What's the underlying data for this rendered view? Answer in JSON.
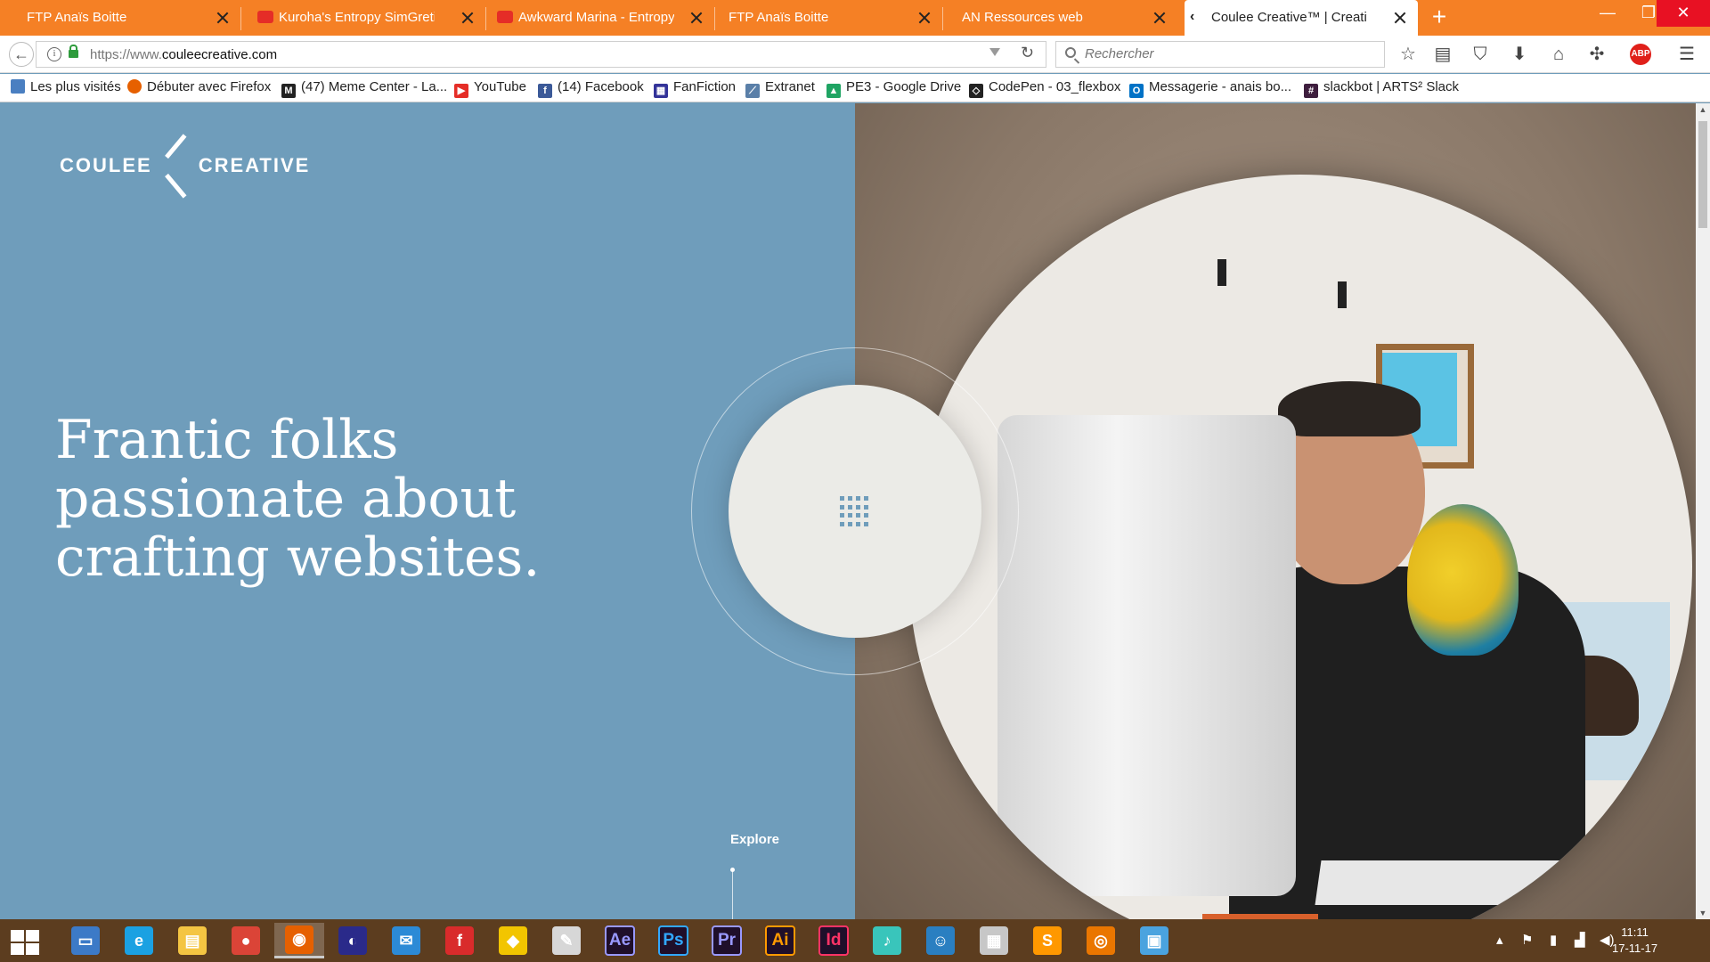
{
  "browser": {
    "tabs": [
      {
        "title": "FTP Anaïs Boitte",
        "favicon": "none"
      },
      {
        "title": "Kuroha's Entropy SimGretina",
        "favicon": "youtube-icon"
      },
      {
        "title": "Awkward Marina - Entropy",
        "favicon": "youtube-icon"
      },
      {
        "title": "FTP Anaïs Boitte",
        "favicon": "none"
      },
      {
        "title": "AN Ressources web",
        "favicon": "none"
      },
      {
        "title": "Coulee Creative™ | Creative",
        "favicon": "coulee-icon"
      }
    ],
    "new_tab_label": "+",
    "url_prefix": "https://www.",
    "url_domain": "couleecreative.com",
    "search_placeholder": "Rechercher",
    "abp_label": "ABP",
    "accent_color": "#f58025"
  },
  "bookmarks": [
    {
      "label": "Les plus visités",
      "icon": "folder-icon",
      "color": "#4a7fc1"
    },
    {
      "label": "Débuter avec Firefox",
      "icon": "firefox-icon",
      "color": "#e66000"
    },
    {
      "label": "(47) Meme Center - La...",
      "icon": "memecenter-icon",
      "color": "#222"
    },
    {
      "label": "YouTube",
      "icon": "youtube-icon",
      "color": "#e52d27"
    },
    {
      "label": "(14) Facebook",
      "icon": "facebook-icon",
      "color": "#3b5998"
    },
    {
      "label": "FanFiction",
      "icon": "fanfiction-icon",
      "color": "#333399"
    },
    {
      "label": "Extranet",
      "icon": "extranet-icon",
      "color": "#5a7fa8"
    },
    {
      "label": "PE3 - Google Drive",
      "icon": "drive-icon",
      "color": "#1fa463"
    },
    {
      "label": "CodePen - 03_flexbox",
      "icon": "codepen-icon",
      "color": "#222"
    },
    {
      "label": "Messagerie - anais bo...",
      "icon": "outlook-icon",
      "color": "#0072c6"
    },
    {
      "label": "slackbot | ARTS² Slack",
      "icon": "slack-icon",
      "color": "#3e1e3e"
    }
  ],
  "page": {
    "logo_left": "COULEE",
    "logo_right": "CREATIVE",
    "headline": "Frantic folks passionate about crafting websites.",
    "explore_label": "Explore",
    "panel_color": "#6f9dbb"
  },
  "taskbar": {
    "apps": [
      {
        "name": "windows-explorer-app",
        "glyph": "▭",
        "bg": "#3c7ac7"
      },
      {
        "name": "internet-explorer-app",
        "glyph": "e",
        "bg": "#1ba1e2"
      },
      {
        "name": "file-explorer-app",
        "glyph": "▤",
        "bg": "#f4c542"
      },
      {
        "name": "chrome-app",
        "glyph": "●",
        "bg": "#db4437"
      },
      {
        "name": "firefox-app",
        "glyph": "◉",
        "bg": "#e66000"
      },
      {
        "name": "audacity-app",
        "glyph": "◐",
        "bg": "#2a2a8a"
      },
      {
        "name": "thunderbird-app",
        "glyph": "✉",
        "bg": "#2c8ad6"
      },
      {
        "name": "flash-app",
        "glyph": "f",
        "bg": "#d92b2b"
      },
      {
        "name": "cyberduck-app",
        "glyph": "◆",
        "bg": "#f2c500"
      },
      {
        "name": "filezilla-app",
        "glyph": "✎",
        "bg": "#d7d7d7"
      },
      {
        "name": "after-effects-app",
        "glyph": "Ae",
        "bg": "#9999ff"
      },
      {
        "name": "photoshop-app",
        "glyph": "Ps",
        "bg": "#31a8ff"
      },
      {
        "name": "premiere-app",
        "glyph": "Pr",
        "bg": "#9999ff"
      },
      {
        "name": "illustrator-app",
        "glyph": "Ai",
        "bg": "#ff9a00"
      },
      {
        "name": "indesign-app",
        "glyph": "Id",
        "bg": "#ff3366"
      },
      {
        "name": "miku-app",
        "glyph": "♪",
        "bg": "#39c5bb"
      },
      {
        "name": "character-app",
        "glyph": "☺",
        "bg": "#2a7fc1"
      },
      {
        "name": "resource-monitor-app",
        "glyph": "▦",
        "bg": "#c7c7c7"
      },
      {
        "name": "sublime-text-app",
        "glyph": "S",
        "bg": "#ff9800"
      },
      {
        "name": "blender-app",
        "glyph": "◎",
        "bg": "#ea7600"
      },
      {
        "name": "control-panel-app",
        "glyph": "▣",
        "bg": "#4aa3df"
      }
    ],
    "time": "11:11",
    "date": "17-11-17"
  }
}
